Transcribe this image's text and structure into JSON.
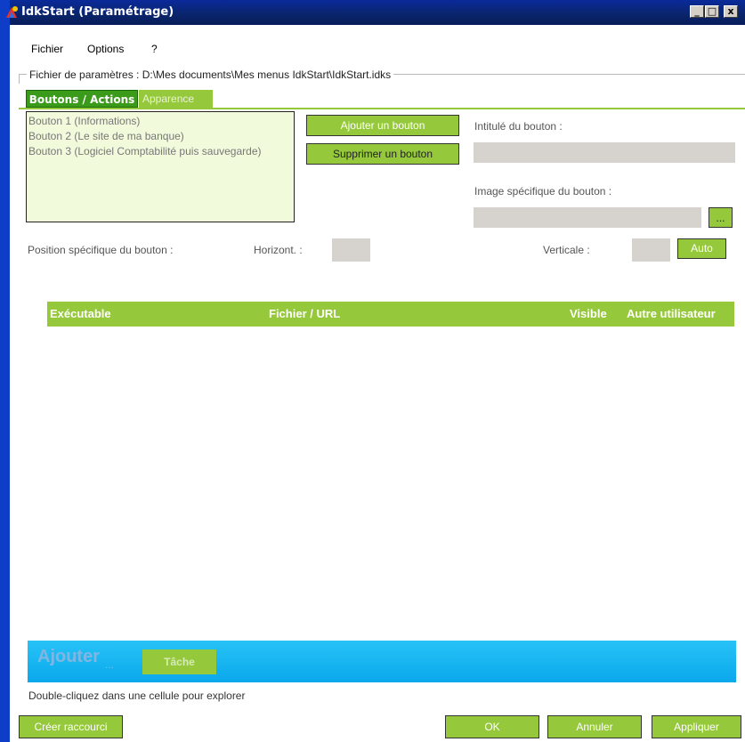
{
  "window": {
    "title": "IdkStart (Paramétrage)",
    "controls": {
      "minimize": "_",
      "maximize": "□",
      "close": "x"
    }
  },
  "menu": {
    "items": [
      "Fichier",
      "Options",
      "?"
    ]
  },
  "settings_file": {
    "label": "Fichier de paramètres : D:\\Mes documents\\Mes menus IdkStart\\IdkStart.idks"
  },
  "tabs": [
    {
      "label": "Boutons / Actions",
      "active": true
    },
    {
      "label": "Apparence",
      "active": false
    }
  ],
  "button_list": {
    "items": [
      "Bouton 1 (Informations)",
      "Bouton 2 (Le site de ma banque)",
      "Bouton 3 (Logiciel Comptabilité puis sauvegarde)"
    ]
  },
  "actions": {
    "add_button": "Ajouter un bouton",
    "delete_button": "Supprimer un bouton"
  },
  "fields": {
    "button_caption_label": "Intitulé du bouton :",
    "button_caption_value": "",
    "button_image_label": "Image spécifique du bouton :",
    "button_image_value": "",
    "browse_label": "...",
    "position_label": "Position spécifique du bouton :",
    "horizontal_label": "Horizont. :",
    "horizontal_value": "",
    "vertical_label": "Verticale :",
    "vertical_value": "",
    "auto_label": "Auto"
  },
  "table": {
    "columns": [
      "Exécutable",
      "Fichier / URL",
      "Visible",
      "Autre utilisateur"
    ],
    "rows": []
  },
  "add_bar": {
    "label": "Ajouter",
    "dots": "...",
    "task_button": "Tâche"
  },
  "hint": "Double-cliquez dans une cellule pour explorer",
  "footer": {
    "create_shortcut": "Créer raccourci",
    "ok": "OK",
    "cancel": "Annuler",
    "apply": "Appliquer"
  },
  "colors": {
    "accent_green": "#95c83a",
    "active_tab": "#3a9a1a",
    "list_bg": "#f1fbdc",
    "blue_bar": "#0aa8ec",
    "title_bar": "#0a246a"
  }
}
